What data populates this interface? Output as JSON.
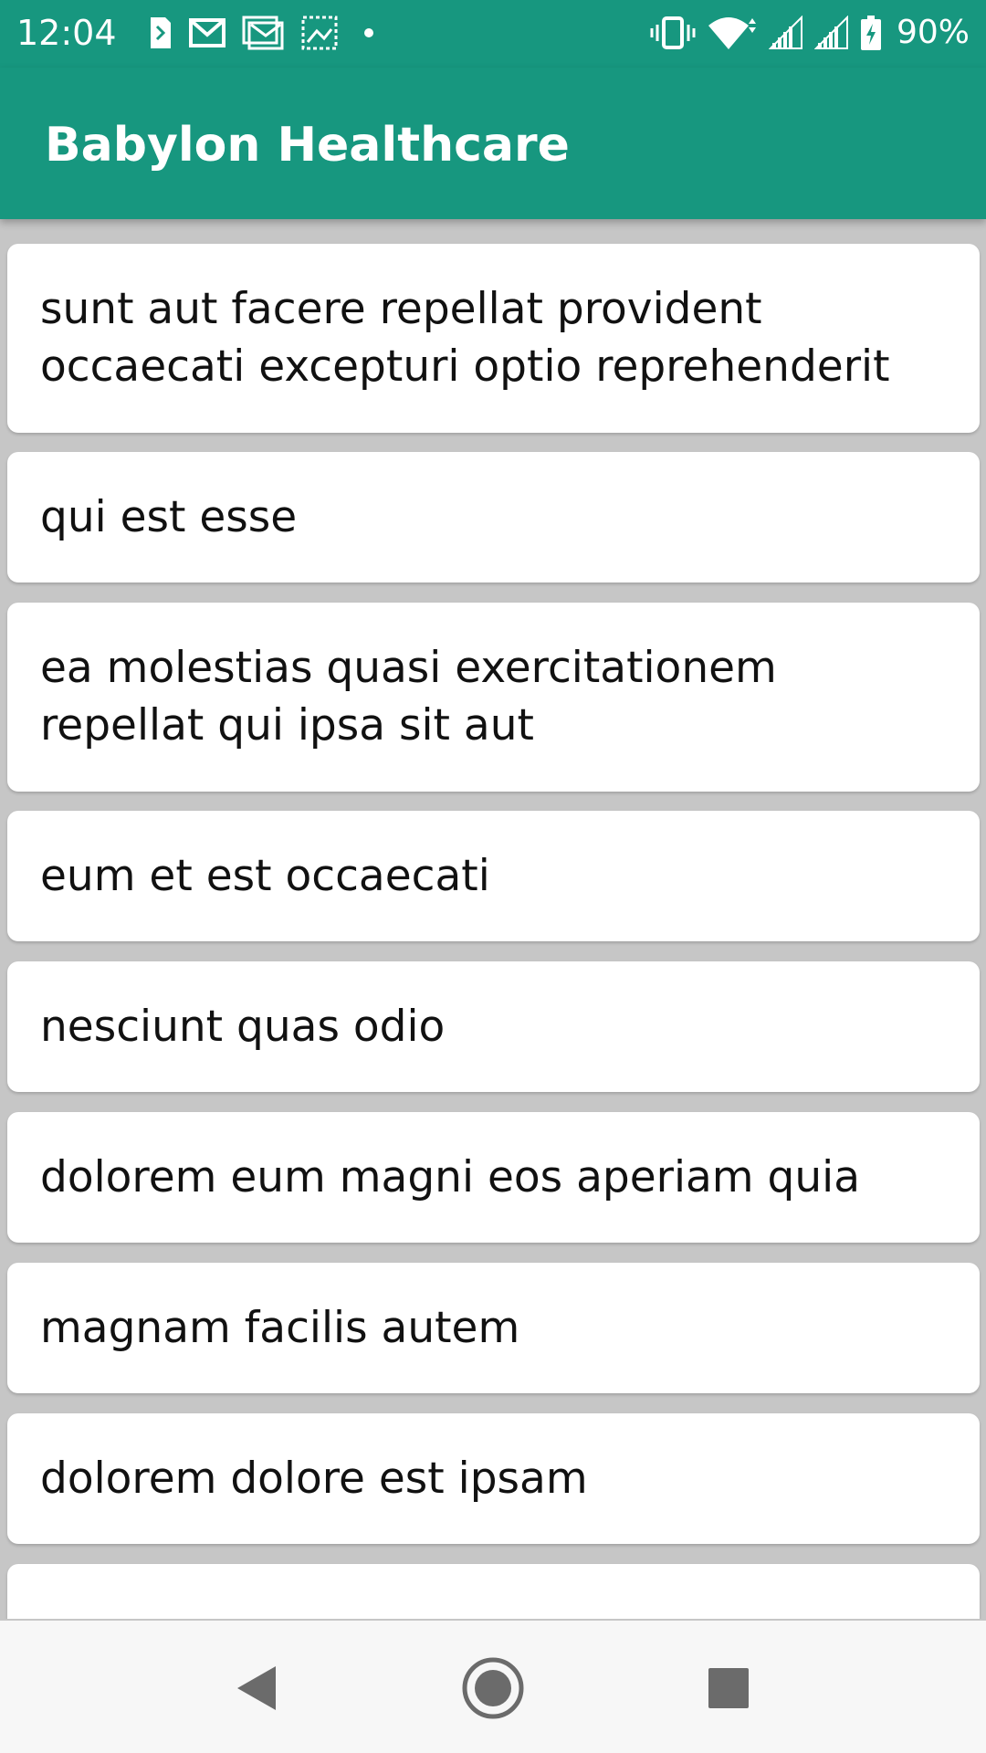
{
  "status_bar": {
    "time": "12:04",
    "battery": "90%",
    "icons_left": [
      "sim-card-icon",
      "gmail-icon",
      "gmail-icon",
      "photo-icon",
      "dot-icon"
    ],
    "icons_right": [
      "vibrate-icon",
      "wifi-icon",
      "signal-icon",
      "signal-icon",
      "battery-charging-icon"
    ]
  },
  "app_bar": {
    "title": "Babylon Healthcare",
    "color": "#17977f"
  },
  "posts": [
    {
      "title": "sunt aut facere repellat provident occaecati excepturi optio reprehenderit"
    },
    {
      "title": "qui est esse"
    },
    {
      "title": "ea molestias quasi exercitationem repellat qui ipsa sit aut"
    },
    {
      "title": "eum et est occaecati"
    },
    {
      "title": "nesciunt quas odio"
    },
    {
      "title": "dolorem eum magni eos aperiam quia"
    },
    {
      "title": "magnam facilis autem"
    },
    {
      "title": "dolorem dolore est ipsam"
    },
    {
      "title": ""
    }
  ],
  "nav_bar": {
    "icons": [
      "back-icon",
      "home-icon",
      "recents-icon"
    ]
  }
}
